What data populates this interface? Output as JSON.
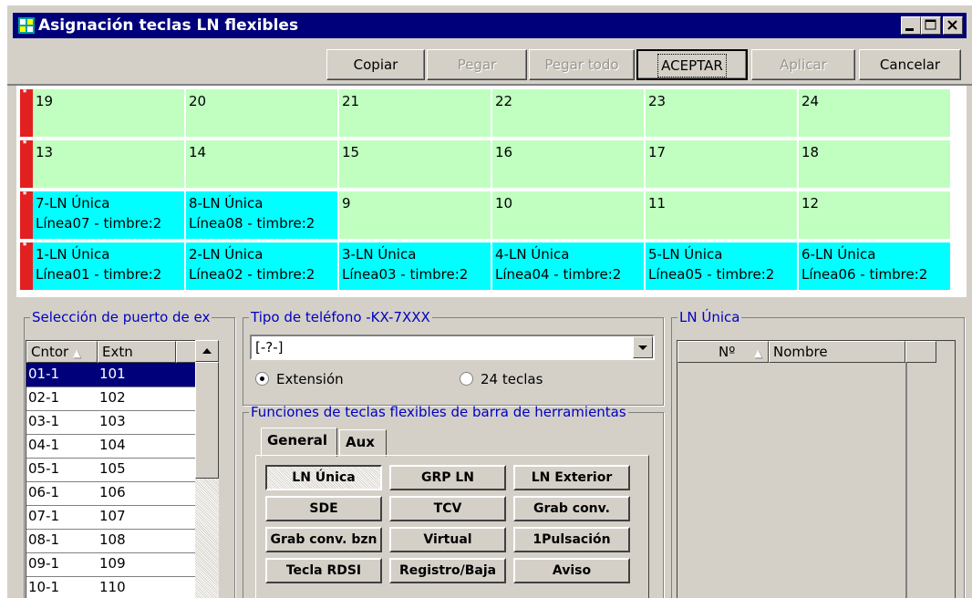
{
  "window": {
    "title": "Asignación teclas LN flexibles"
  },
  "toolbar": {
    "copy_label": "Copiar",
    "paste_label": "Pegar",
    "paste_all_label": "Pegar todo",
    "accept_label": "ACEPTAR",
    "apply_label": "Aplicar",
    "cancel_label": "Cancelar"
  },
  "grid": {
    "rows": [
      {
        "cells": [
          {
            "l1": "19",
            "l2": ""
          },
          {
            "l1": "20",
            "l2": ""
          },
          {
            "l1": "21",
            "l2": ""
          },
          {
            "l1": "22",
            "l2": ""
          },
          {
            "l1": "23",
            "l2": ""
          },
          {
            "l1": "24",
            "l2": ""
          }
        ]
      },
      {
        "cells": [
          {
            "l1": "13",
            "l2": ""
          },
          {
            "l1": "14",
            "l2": ""
          },
          {
            "l1": "15",
            "l2": ""
          },
          {
            "l1": "16",
            "l2": ""
          },
          {
            "l1": "17",
            "l2": ""
          },
          {
            "l1": "18",
            "l2": ""
          }
        ]
      },
      {
        "cells": [
          {
            "l1": "7-LN Única",
            "l2": "Línea07  - timbre:2"
          },
          {
            "l1": "8-LN Única",
            "l2": "Línea08  - timbre:2"
          },
          {
            "l1": "9",
            "l2": ""
          },
          {
            "l1": "10",
            "l2": ""
          },
          {
            "l1": "11",
            "l2": ""
          },
          {
            "l1": "12",
            "l2": ""
          }
        ]
      },
      {
        "cells": [
          {
            "l1": "1-LN Única",
            "l2": "Línea01  - timbre:2"
          },
          {
            "l1": "2-LN Única",
            "l2": "Línea02  - timbre:2"
          },
          {
            "l1": "3-LN Única",
            "l2": "Línea03  - timbre:2"
          },
          {
            "l1": "4-LN Única",
            "l2": "Línea04  - timbre:2"
          },
          {
            "l1": "5-LN Única",
            "l2": "Línea05  - timbre:2"
          },
          {
            "l1": "6-LN Única",
            "l2": "Línea06  - timbre:2"
          }
        ]
      }
    ]
  },
  "port_select": {
    "legend": "Selección de puerto de ex",
    "col_cntor": "Cntor",
    "col_extn": "Extn",
    "rows": [
      {
        "cntor": "01-1",
        "extn": "101"
      },
      {
        "cntor": "02-1",
        "extn": "102"
      },
      {
        "cntor": "03-1",
        "extn": "103"
      },
      {
        "cntor": "04-1",
        "extn": "104"
      },
      {
        "cntor": "05-1",
        "extn": "105"
      },
      {
        "cntor": "06-1",
        "extn": "106"
      },
      {
        "cntor": "07-1",
        "extn": "107"
      },
      {
        "cntor": "08-1",
        "extn": "108"
      },
      {
        "cntor": "09-1",
        "extn": "109"
      },
      {
        "cntor": "10-1",
        "extn": "110"
      }
    ]
  },
  "phone_type": {
    "legend": "Tipo de teléfono -KX-7XXX",
    "combo_value": "[-?-]",
    "radio_ext": "Extensión",
    "radio_24": "24 teclas"
  },
  "functions": {
    "legend": "Funciones de teclas flexibles de barra de herramientas",
    "tab_general": "General",
    "tab_aux": "Aux",
    "buttons": [
      "LN Única",
      "GRP LN",
      "LN Exterior",
      "SDE",
      "TCV",
      "Grab conv.",
      "Grab conv. bzn",
      "Virtual",
      "1Pulsación",
      "Tecla RDSI",
      "Registro/Baja",
      "Aviso"
    ]
  },
  "ln_unica": {
    "legend": "LN Única",
    "col_no": "Nº",
    "col_name": "Nombre"
  }
}
